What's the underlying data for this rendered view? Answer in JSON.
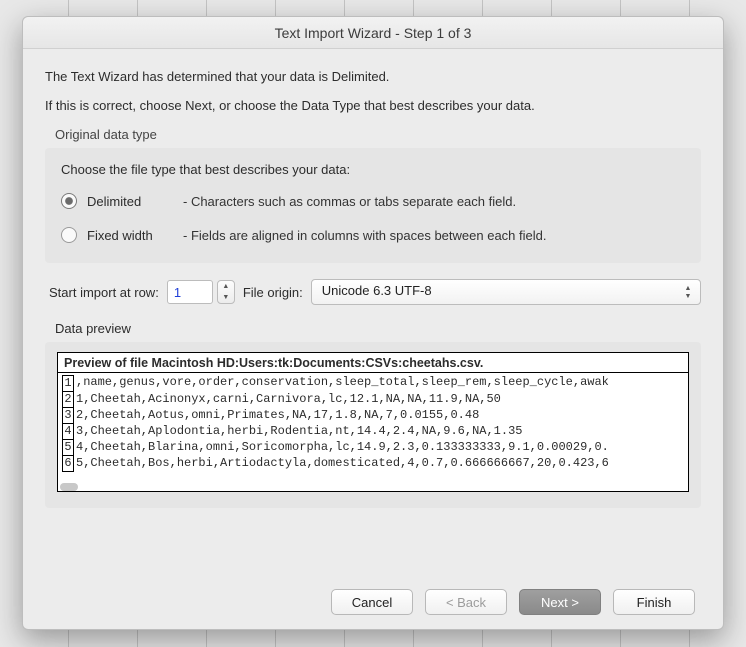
{
  "title": "Text Import Wizard - Step 1 of 3",
  "intro1": "The Text Wizard has determined that your data is Delimited.",
  "intro2": "If this is correct, choose Next, or choose the Data Type that best describes your data.",
  "group": {
    "label": "Original data type",
    "instruction": "Choose the file type that best describes your data:",
    "options": {
      "delimited": {
        "label": "Delimited",
        "desc": "- Characters such as commas or tabs separate each field.",
        "selected": true
      },
      "fixed": {
        "label": "Fixed width",
        "desc": "- Fields are aligned in columns with spaces between each field.",
        "selected": false
      }
    }
  },
  "importRow": {
    "label": "Start import at row:",
    "value": "1",
    "originLabel": "File origin:",
    "originValue": "Unicode 6.3 UTF-8"
  },
  "preview": {
    "label": "Data preview",
    "header": "Preview of file Macintosh HD:Users:tk:Documents:CSVs:cheetahs.csv.",
    "lines": [
      {
        "n": "1",
        "t": ",name,genus,vore,order,conservation,sleep_total,sleep_rem,sleep_cycle,awak"
      },
      {
        "n": "2",
        "t": "1,Cheetah,Acinonyx,carni,Carnivora,lc,12.1,NA,NA,11.9,NA,50"
      },
      {
        "n": "3",
        "t": "2,Cheetah,Aotus,omni,Primates,NA,17,1.8,NA,7,0.0155,0.48"
      },
      {
        "n": "4",
        "t": "3,Cheetah,Aplodontia,herbi,Rodentia,nt,14.4,2.4,NA,9.6,NA,1.35"
      },
      {
        "n": "5",
        "t": "4,Cheetah,Blarina,omni,Soricomorpha,lc,14.9,2.3,0.133333333,9.1,0.00029,0."
      },
      {
        "n": "6",
        "t": "5,Cheetah,Bos,herbi,Artiodactyla,domesticated,4,0.7,0.666666667,20,0.423,6"
      }
    ]
  },
  "buttons": {
    "cancel": "Cancel",
    "back": "< Back",
    "next": "Next >",
    "finish": "Finish"
  }
}
